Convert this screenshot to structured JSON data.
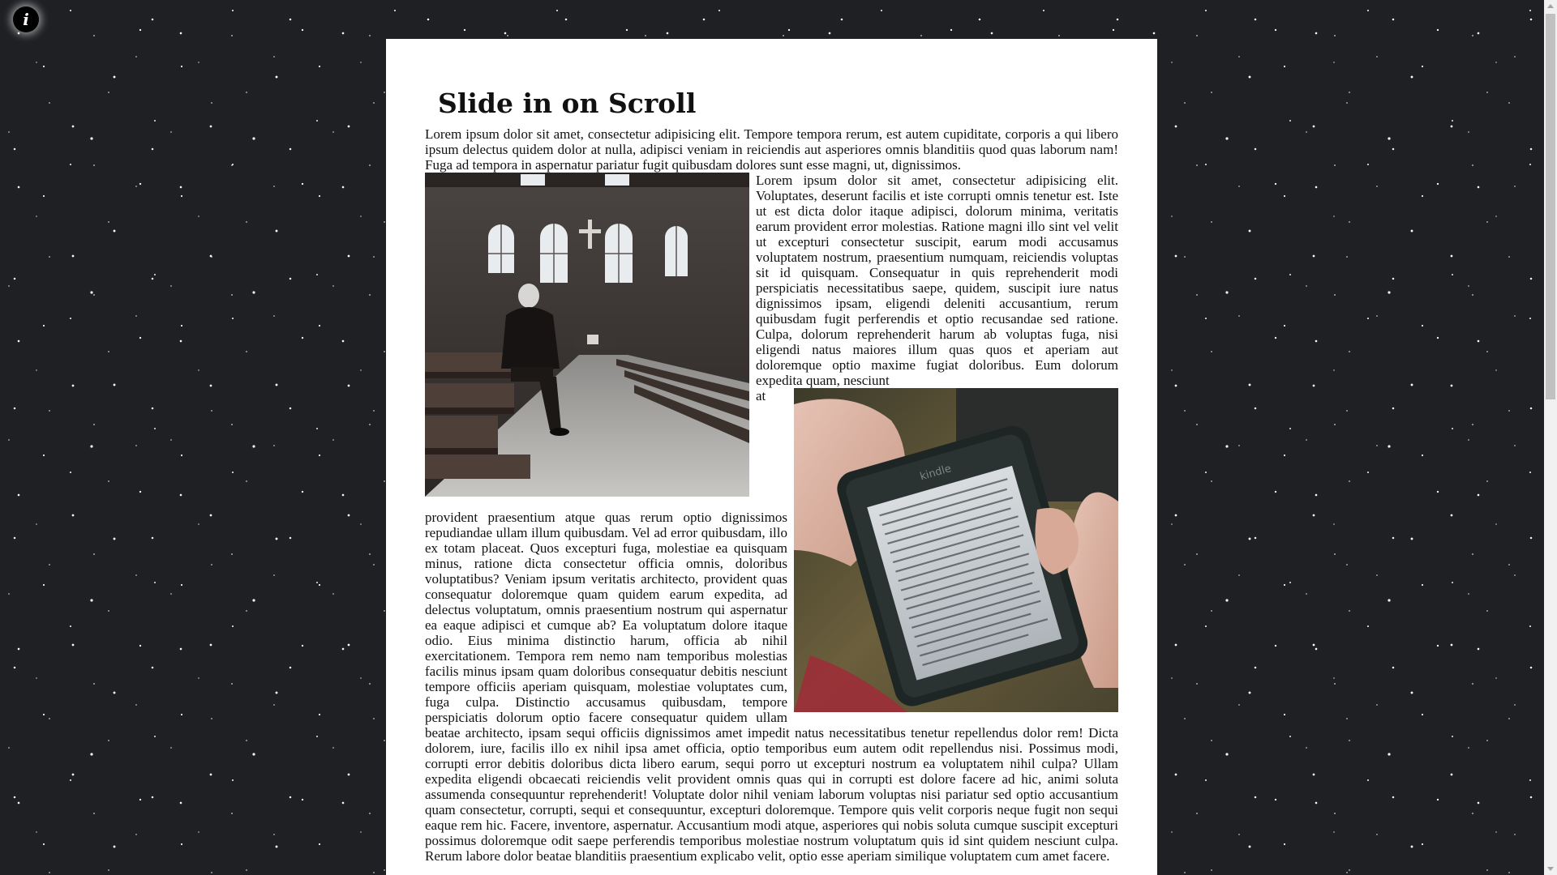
{
  "info_button": {
    "label": "i"
  },
  "article": {
    "title": "Slide in on Scroll",
    "paragraphs": [
      "Lorem ipsum dolor sit amet, consectetur adipisicing elit. Tempore tempora rerum, est autem cupiditate, corporis a qui libero ipsum delectus quidem dolor at nulla, adipisci veniam in reiciendis aut asperiores omnis blanditiis quod quas laborum nam! Fuga ad tempora in aspernatur pariatur fugit quibusdam dolores sunt esse magni, ut, dignissimos.",
      "Lorem ipsum dolor sit amet, consectetur adipisicing elit. Voluptates, deserunt facilis et iste corrupti omnis tenetur est. Iste ut est dicta dolor itaque adipisci, dolorum minima, veritatis earum provident error molestias. Ratione magni illo sint vel velit ut excepturi consectetur suscipit, earum modi accusamus voluptatem nostrum, praesentium numquam, reiciendis voluptas sit id quisquam. Consequatur in quis reprehenderit modi perspiciatis necessitatibus saepe, quidem, suscipit iure natus dignissimos ipsam, eligendi deleniti accusantium, rerum quibusdam fugit perferendis et optio recusandae sed ratione. Culpa, dolorum reprehenderit harum ab voluptas fuga, nisi eligendi natus maiores illum quas quos et aperiam aut doloremque optio maxime fugiat doloribus. Eum dolorum expedita quam, nesciunt",
      "at provident praesentium atque quas rerum optio dignissimos repudiandae ullam illum quibusdam. Vel ad error quibusdam, illo ex totam placeat. Quos excepturi fuga, molestiae ea quisquam minus, ratione dicta consectetur officia omnis, doloribus voluptatibus? Veniam ipsum veritatis architecto, provident quas consequatur doloremque quam quidem earum expedita, ad delectus voluptatum, omnis praesentium nostrum qui aspernatur ea eaque adipisci et cumque ab? Ea voluptatum dolore itaque odio. Eius minima distinctio harum, officia ab nihil exercitationem. Tempora rem nemo nam temporibus molestias facilis minus ipsam quam doloribus consequatur debitis nesciunt tempore officiis aperiam quisquam, molestiae voluptates cum, fuga culpa. Distinctio accusamus quibusdam, tempore perspiciatis dolorum optio facere consequatur quidem ullam beatae architecto, ipsam sequi officiis dignissimos amet impedit natus necessitatibus tenetur repellendus dolor rem! Dicta dolorem, iure, facilis illo ex nihil ipsa amet officia, optio temporibus eum autem odit repellendus nisi. Possimus modi, corrupti error debitis doloribus dicta libero earum, sequi porro ut excepturi nostrum ea voluptatem nihil culpa? Ullam expedita eligendi obcaecati reiciendis velit provident omnis quas qui in corrupti est dolore facere ad hic, animi soluta assumenda consequuntur reprehenderit! Voluptate dolor nihil veniam laborum voluptas nisi pariatur sed optio accusantium quam consectetur, corrupti, sequi et consequuntur, excepturi doloremque. Tempore quis velit corporis neque fugit non sequi eaque rem hic. Facere, inventore, aspernatur. Accusantium modi atque, asperiores qui nobis soluta cumque suscipit excepturi possimus doloremque odit saepe perferendis temporibus molestiae nostrum voluptatum quis id sint quidem nesciunt culpa. Rerum labore dolor beatae blanditiis praesentium explicabo velit, optio esse aperiam similique voluptatem cum amet facere."
    ],
    "images": [
      {
        "name": "church-photo",
        "description_icon": "photo-icon"
      },
      {
        "name": "ereader-photo",
        "description_icon": "photo-icon",
        "device_brand": "kindle"
      }
    ]
  },
  "colors": {
    "background": "#1e2024",
    "page": "#ffffff",
    "text": "#111111"
  }
}
